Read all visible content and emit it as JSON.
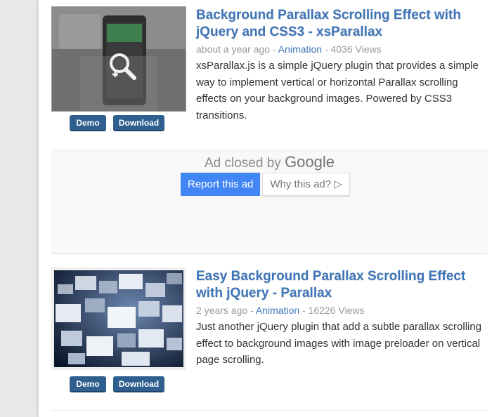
{
  "articles": [
    {
      "title": "Background Parallax Scrolling Effect with jQuery and CSS3 - xsParallax",
      "title_line1": "Background Parallax Scrolling Effect with",
      "title_line2": "jQuery and CSS3 - xsParallax",
      "time": "about a year ago",
      "sep1": " - ",
      "category": "Animation",
      "views": " - 4036 Views",
      "description": "xsParallax.js is a simple jQuery plugin that provides a simple way to implement vertical or horizontal Parallax scrolling effects on your background images. Powered by CSS3 transitions.",
      "demo_label": "Demo",
      "download_label": "Download"
    },
    {
      "title": "Easy Background Parallax Scrolling Effect with jQuery - Parallax",
      "title_line1": "Easy Background Parallax Scrolling Effect",
      "title_line2": "with jQuery - Parallax",
      "time": "2 years ago",
      "sep1": " - ",
      "category": "Animation",
      "views": " - 16226 Views",
      "description": "Just another jQuery plugin that add a subtle parallax scrolling effect to background images with image preloader on vertical page scrolling.",
      "demo_label": "Demo",
      "download_label": "Download"
    }
  ],
  "ad": {
    "closed_text": "Ad closed by ",
    "brand": "Google",
    "report_label": "Report this ad",
    "why_label": "Why this ad? ▷"
  },
  "colors": {
    "link": "#3e74b8",
    "button": "#2e5f8e",
    "report": "#4285f4"
  },
  "icons": [
    "magnifier-icon",
    "play-triangle-icon"
  ]
}
